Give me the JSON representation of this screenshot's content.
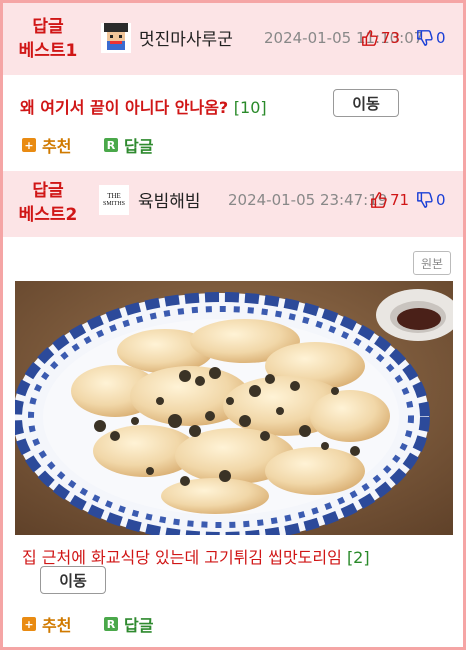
{
  "posts": [
    {
      "badge_line1": "답글",
      "badge_line2": "베스트1",
      "nickname": "멋진마사루군",
      "date": "2024-01-05 11:10:07",
      "upvotes": "73",
      "downvotes": "0",
      "title": "왜 여기서 끝이 아니다 안나옴?",
      "reply_count": "[10]",
      "move_label": "이동",
      "recommend_label": "추천",
      "reply_label": "답글",
      "avatar_icon": "pixel-character-icon"
    },
    {
      "badge_line1": "답글",
      "badge_line2": "베스트2",
      "nickname": "육빔해빔",
      "date": "2024-01-05 23:47:19",
      "upvotes": "71",
      "downvotes": "0",
      "avatar_text_1": "THE",
      "avatar_text_2": "SMITHS",
      "original_label": "원본",
      "title": "집 근처에 화교식당 있는데 고기튀김 씹맛도리임",
      "reply_count": "[2]",
      "move_label": "이동",
      "recommend_label": "추천",
      "reply_label": "답글"
    }
  ],
  "colors": {
    "border": "#f5a5a5",
    "header_bg": "#fce4e6",
    "accent_red": "#d01616",
    "green": "#2a8a2a",
    "orange": "#d07a00",
    "down_blue": "#1a3fd6"
  }
}
